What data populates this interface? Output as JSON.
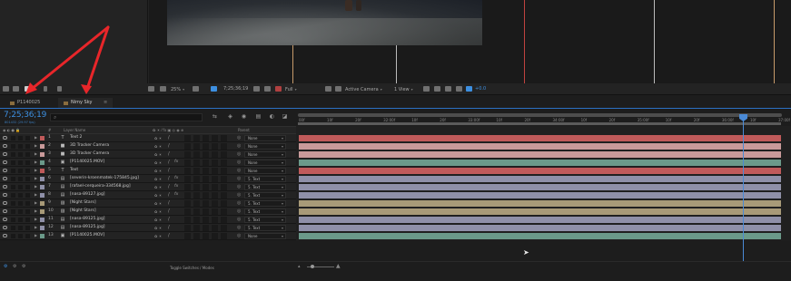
{
  "colors": {
    "accent_blue": "#2b70c4",
    "timecode_blue": "#3d8fe0",
    "arrow_red": "#e8262a",
    "bar_red": "#c05a5a",
    "bar_pink": "#c99a9a",
    "bar_blue_grey": "#8f90a8",
    "bar_teal": "#6b9a8a",
    "bar_tan": "#a89a78"
  },
  "viewer_toolbar": {
    "zoom": "25%",
    "timecode": "7;25;36;19",
    "resolution": "Full",
    "camera": "Active Camera",
    "view": "1 View",
    "exposure": "+0.0"
  },
  "tabs": [
    {
      "label": "P1140025"
    },
    {
      "label": "Nimy Sky"
    }
  ],
  "timecode": {
    "main": "7;25;36;19",
    "sub": "801432 (29.97 fps)"
  },
  "ruler_labels": [
    "00f",
    "10f",
    "20f",
    "32:00f",
    "10f",
    "20f",
    "33:00f",
    "10f",
    "20f",
    "34:00f",
    "10f",
    "20f",
    "35:00f",
    "10f",
    "20f",
    "36:00f",
    "10f",
    "37:00f"
  ],
  "column_headers": {
    "num": "#",
    "layer_name": "Layer Name",
    "parent": "Parent"
  },
  "layers": [
    {
      "num": "1",
      "type_icon": "text-icon",
      "name": "Text 2",
      "label_color": "#c05a5a",
      "fx": false,
      "parent": "None",
      "track_color": "#c05a5a"
    },
    {
      "num": "2",
      "type_icon": "camera-icon",
      "name": "3D Tracker Camera",
      "label_color": "#c99a9a",
      "fx": false,
      "parent": "None",
      "track_color": "#c99a9a"
    },
    {
      "num": "3",
      "type_icon": "camera-icon",
      "name": "3D Tracker Camera",
      "label_color": "#c99a9a",
      "fx": false,
      "parent": "None",
      "track_color": "#c99a9a"
    },
    {
      "num": "4",
      "type_icon": "footage-icon",
      "name": "[P1140025.MOV]",
      "label_color": "#6b9a8a",
      "fx": true,
      "parent": "None",
      "track_color": "#6b9a8a"
    },
    {
      "num": "5",
      "type_icon": "text-icon",
      "name": "Text",
      "label_color": "#c05a5a",
      "fx": false,
      "parent": "None",
      "track_color": "#c05a5a"
    },
    {
      "num": "6",
      "type_icon": "image-icon",
      "name": "[severin-kroenmatek-175845.jpg]",
      "label_color": "#8f90a8",
      "fx": true,
      "parent": "5. Text",
      "track_color": "#8f90a8"
    },
    {
      "num": "7",
      "type_icon": "image-icon",
      "name": "[rafael-cerqueira-334568.jpg]",
      "label_color": "#8f90a8",
      "fx": true,
      "parent": "5. Text",
      "track_color": "#8f90a8"
    },
    {
      "num": "8",
      "type_icon": "image-icon",
      "name": "[nasa-89127.jpg]",
      "label_color": "#8f90a8",
      "fx": true,
      "parent": "5. Text",
      "track_color": "#8f90a8"
    },
    {
      "num": "9",
      "type_icon": "solid-icon",
      "name": "[Night Stars]",
      "label_color": "#a89a78",
      "fx": false,
      "parent": "5. Text",
      "track_color": "#a89a78"
    },
    {
      "num": "10",
      "type_icon": "solid-icon",
      "name": "[Night Stars]",
      "label_color": "#a89a78",
      "fx": false,
      "parent": "5. Text",
      "track_color": "#a89a78"
    },
    {
      "num": "11",
      "type_icon": "image-icon",
      "name": "[nasa-89125.jpg]",
      "label_color": "#8f90a8",
      "fx": false,
      "parent": "5. Text",
      "track_color": "#8f90a8"
    },
    {
      "num": "12",
      "type_icon": "image-icon",
      "name": "[nasa-89125.jpg]",
      "label_color": "#8f90a8",
      "fx": false,
      "parent": "5. Text",
      "track_color": "#8f90a8"
    },
    {
      "num": "13",
      "type_icon": "footage-icon",
      "name": "[P1140025.MOV]",
      "label_color": "#6b9a8a",
      "fx": false,
      "parent": "None",
      "track_color": "#6b9a8a"
    }
  ],
  "bottom_bar": {
    "toggle_label": "Toggle Switches / Modes"
  }
}
